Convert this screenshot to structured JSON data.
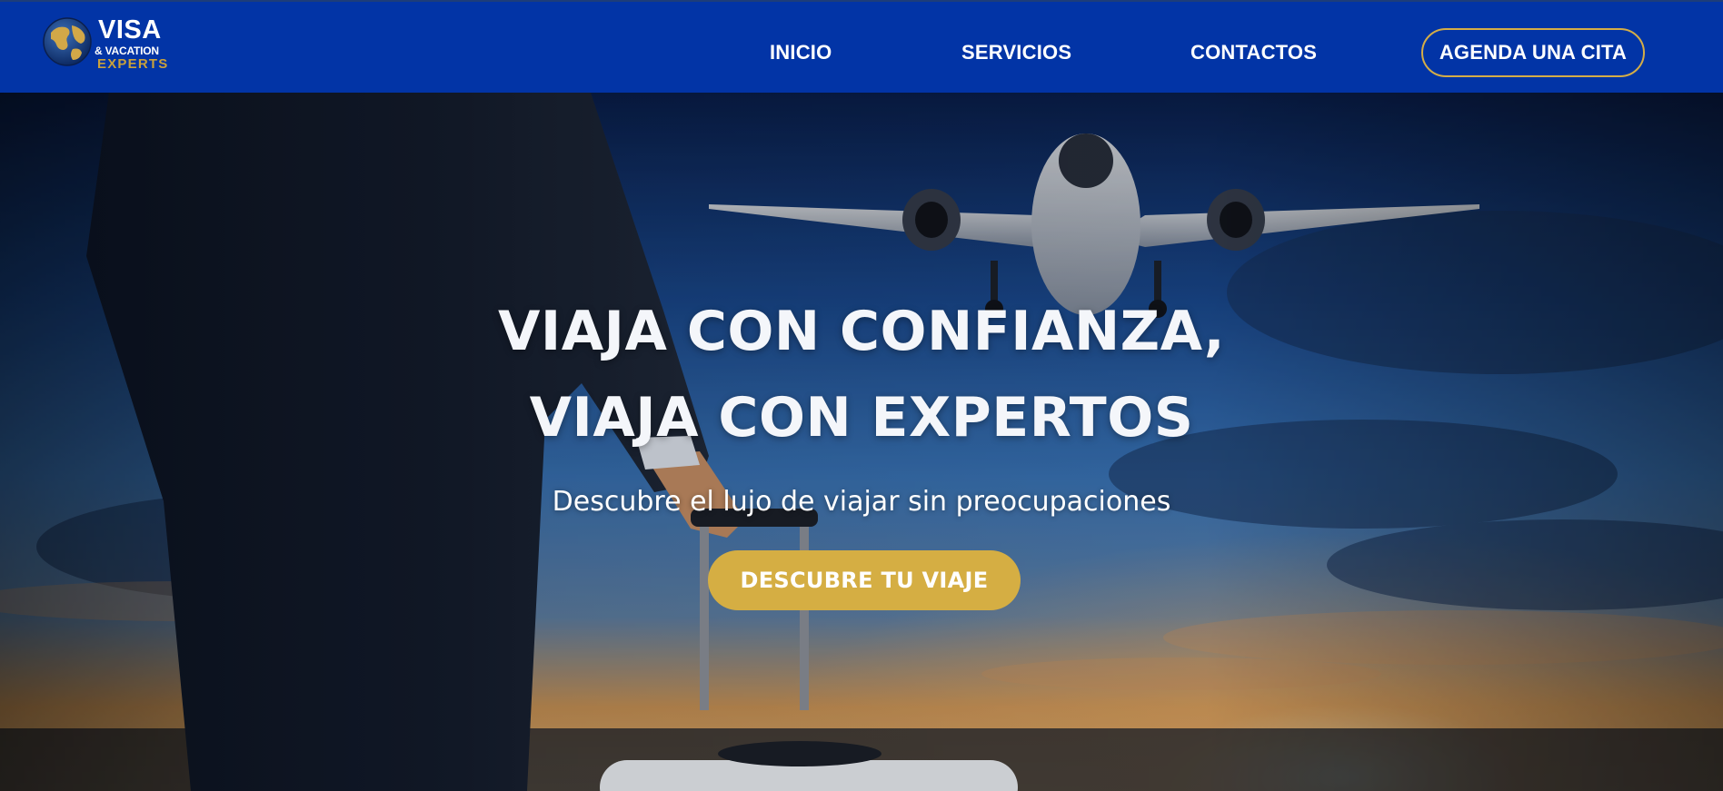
{
  "brand": {
    "line1": "VISA",
    "line2": "& VACATION",
    "line3": "EXPERTS",
    "globe_icon": "globe-icon"
  },
  "nav": {
    "links": [
      {
        "label": "INICIO"
      },
      {
        "label": "SERVICIOS"
      },
      {
        "label": "CONTACTOS"
      }
    ],
    "cta_label": "AGENDA UNA CITA"
  },
  "hero": {
    "title_line1": "VIAJA CON CONFIANZA,",
    "title_line2": "VIAJA CON EXPERTOS",
    "subtitle": "Descubre el lujo de viajar sin preocupaciones",
    "cta_label": "DESCUBRE TU VIAJE"
  },
  "colors": {
    "nav_bg": "#0234a6",
    "accent_gold": "#d5ae43",
    "text_white": "#ffffff"
  }
}
